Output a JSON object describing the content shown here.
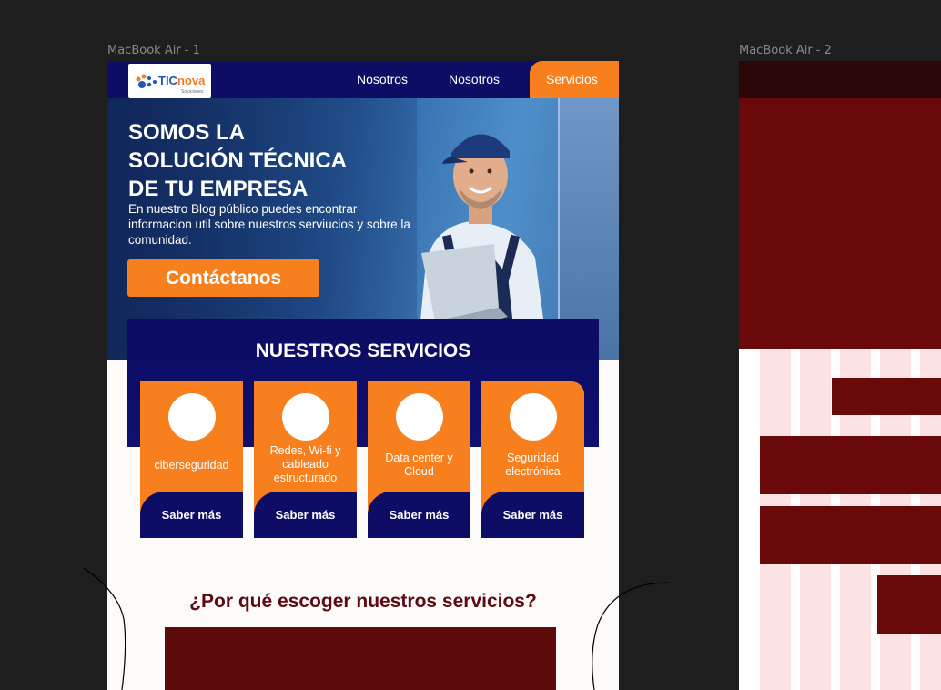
{
  "frames": {
    "frame1_label": "MacBook Air - 1",
    "frame2_label": "MacBook Air - 2"
  },
  "nav": {
    "logo_tic": "TIC",
    "logo_nova": "nova",
    "logo_sub": "Soluciones",
    "items": [
      "Nosotros",
      "Nosotros"
    ],
    "active": "Servicios"
  },
  "hero": {
    "title_lines": [
      "SOMOS LA",
      "SOLUCIÓN TÉCNICA",
      "DE TU EMPRESA"
    ],
    "description": "En nuestro Blog público puedes encontrar informacion util sobre nuestros serviucios y sobre la comunidad.",
    "cta": "Contáctanos"
  },
  "services": {
    "title": "NUESTROS SERVICIOS",
    "cards": [
      {
        "label": "ciberseguridad",
        "button": "Saber más"
      },
      {
        "label": "Redes, Wi-fi y cableado estructurado",
        "button": "Saber más"
      },
      {
        "label": "Data center y Cloud",
        "button": "Saber más"
      },
      {
        "label": "Seguridad electrónica",
        "button": "Saber más"
      }
    ]
  },
  "why": {
    "title": "¿Por qué escoger nuestros servicios?"
  },
  "colors": {
    "canvas": "#1e1e1e",
    "navy": "#0d0d66",
    "orange": "#f77f1e",
    "maroon": "#5e0b0b",
    "grid_pink": "#fde2e4"
  }
}
